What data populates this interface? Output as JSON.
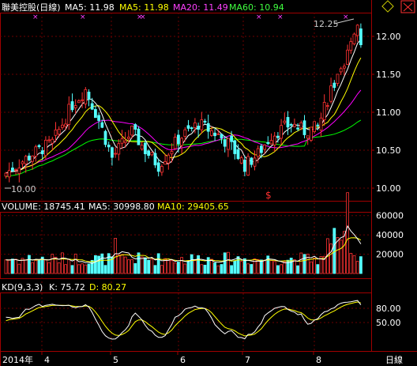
{
  "header": {
    "stock_name": "聯美控股(日線)",
    "ma5": "MA5: 11.98",
    "ma5b": "MA5: 11.98",
    "ma20": "MA20: 11.49",
    "ma60": "MA60: 10.94"
  },
  "volume_header": {
    "label": "VOLUME: 18745.41",
    "ma5": "MA5: 30998.80",
    "ma10": "MA10: 29405.65"
  },
  "kd_header": {
    "label": "KD(9,3,3)",
    "k": "K: 75.72",
    "d": "D: 80.27"
  },
  "annotations": {
    "high": "12.25",
    "low": "10.00",
    "marker": "$"
  },
  "price_axis": [
    "12.00",
    "11.50",
    "11.00",
    "10.50",
    "10.00"
  ],
  "volume_axis": [
    "60000",
    "40000",
    "20000"
  ],
  "kd_axis": [
    "80.00",
    "50.00"
  ],
  "time_axis": [
    "2014年",
    "4",
    "5",
    "6",
    "7",
    "8"
  ],
  "footer": {
    "period": "日線"
  },
  "colors": {
    "up": "#ff3232",
    "down": "#54ffff",
    "ma5": "#ffffff",
    "ma10": "#ffff00",
    "ma20": "#ff00ff",
    "ma60": "#00ff00",
    "grid": "#8b0000"
  },
  "icons": {
    "close": "close-box-icon"
  }
}
